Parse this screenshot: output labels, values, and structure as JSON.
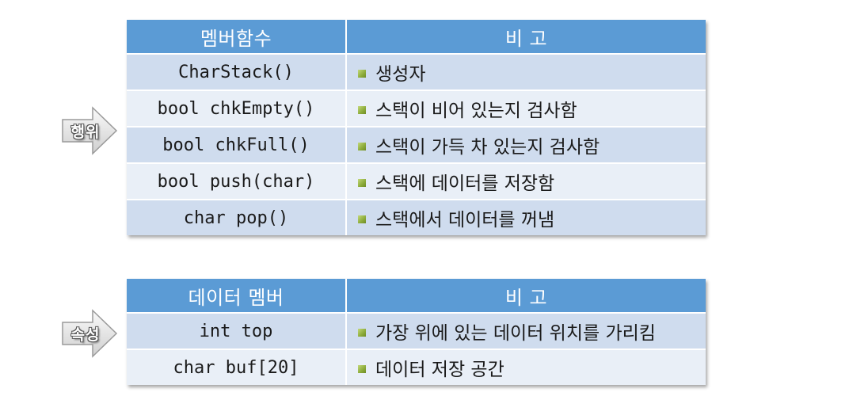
{
  "behavior_label": "행위",
  "attribute_label": "속성",
  "member_functions_table": {
    "headers": [
      "멤버함수",
      "비 고"
    ],
    "rows": [
      {
        "code": "CharStack()",
        "note": "생성자"
      },
      {
        "code": "bool chkEmpty()",
        "note": "스택이 비어 있는지 검사함"
      },
      {
        "code": "bool chkFull()",
        "note": "스택이 가득 차 있는지 검사함"
      },
      {
        "code": "bool push(char)",
        "note": "스택에 데이터를 저장함"
      },
      {
        "code": "char pop()",
        "note": "스택에서 데이터를 꺼냄"
      }
    ]
  },
  "data_members_table": {
    "headers": [
      "데이터 멤버",
      "비 고"
    ],
    "rows": [
      {
        "code": "int top",
        "note": "가장 위에 있는 데이터 위치를 가리킴"
      },
      {
        "code": "char buf[20]",
        "note": "데이터 저장 공간"
      }
    ]
  },
  "colors": {
    "header_bg": "#5b9bd5",
    "row_odd_bg": "#cfdcee",
    "row_even_bg": "#e9eff7",
    "bullet": "#8cab3a",
    "arrow_fill": "#e8e8e8"
  }
}
